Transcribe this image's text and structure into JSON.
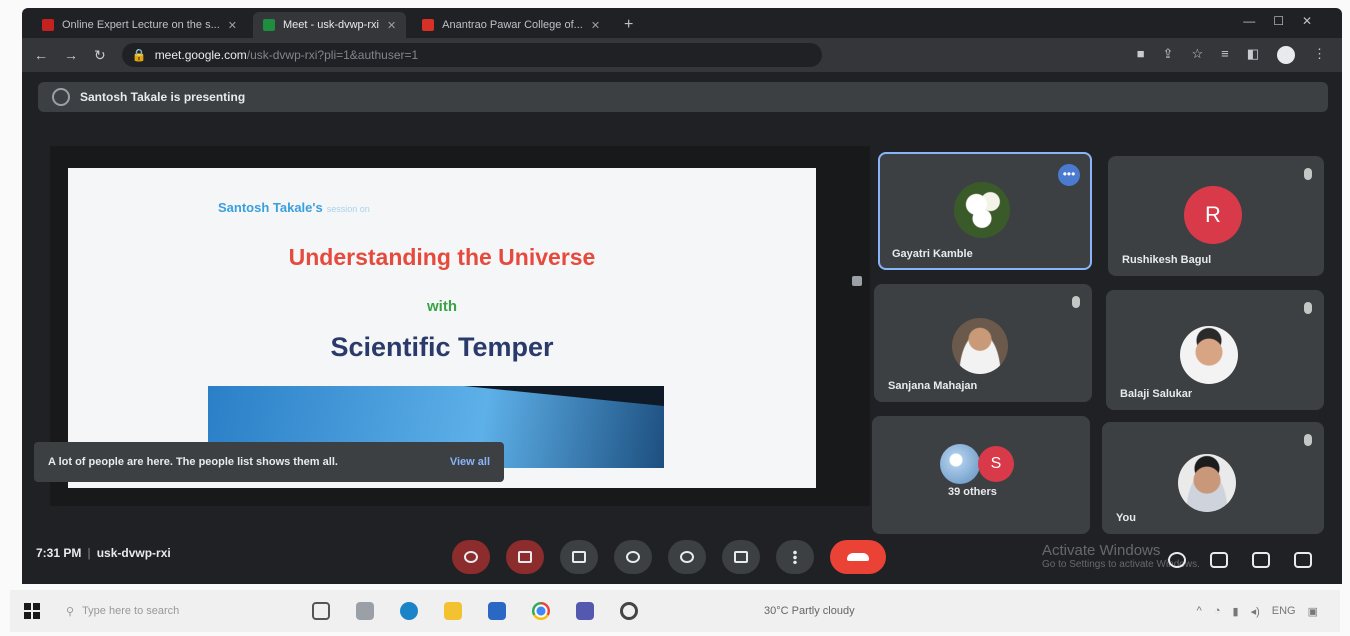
{
  "browser": {
    "tabs": [
      {
        "label": "Online Expert Lecture on the s...",
        "color": "#c5221f",
        "active": false
      },
      {
        "label": "Meet - usk-dvwp-rxi",
        "color": "#1e8e3e",
        "active": true
      },
      {
        "label": "Anantrao Pawar College of...",
        "color": "#d93025",
        "active": false
      }
    ],
    "new_tab": "+",
    "url_host": "meet.google.com",
    "url_path": "/usk-dvwp-rxi?pli=1&authuser=1"
  },
  "meet": {
    "presenting_text": "Santosh Takale is presenting",
    "slide": {
      "author": "Santosh Takale's",
      "author_suffix": "session on",
      "title_line1": "Understanding the Universe",
      "title_line2": "with",
      "title_line3": "Scientific Temper"
    },
    "toast": {
      "message": "A lot of people are here. The people list shows them all.",
      "action": "View all"
    },
    "participants": [
      {
        "name": "Gayatri Kamble",
        "speaking": true,
        "avatar": "flower-photo"
      },
      {
        "name": "Rushikesh Bagul",
        "initial": "R",
        "avatar": "letter"
      },
      {
        "name": "Sanjana Mahajan",
        "avatar": "person-photo"
      },
      {
        "name": "Balaji Salukar",
        "avatar": "person-photo"
      },
      {
        "name": "39 others",
        "initial": "S",
        "avatar": "group"
      },
      {
        "name": "You",
        "avatar": "person-photo"
      }
    ],
    "time": "7:31 PM",
    "meeting_code": "usk-dvwp-rxi",
    "activate": "Activate Windows",
    "activate_sub": "Go to Settings to activate Windows."
  },
  "taskbar": {
    "search_placeholder": "Type here to search",
    "weather": "30°C Partly cloudy",
    "lang": "ENG"
  }
}
